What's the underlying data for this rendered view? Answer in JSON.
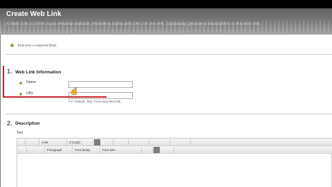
{
  "header": {
    "title": "Create Web Link",
    "subtitle": "A Web Link is a link to an external website. Provide a name and URL for the link. Optionally, provide a description of the web link."
  },
  "required_note": "Indicates a required field.",
  "section1": {
    "number": "1.",
    "title": "Web Link Information",
    "name_label": "Name",
    "url_label": "URL",
    "name_value": "",
    "url_value": "",
    "url_example": "For example, http://www.myschool.edu"
  },
  "section2": {
    "number": "2.",
    "title": "Description",
    "text_label": "Text"
  },
  "editor": {
    "row1": [
      "",
      "Arial",
      "3 (12pt)",
      "",
      "",
      "",
      "",
      ""
    ],
    "row2": [
      "",
      "",
      "Paragraph",
      "Font family",
      "Font size",
      "",
      ""
    ]
  },
  "colors": {
    "accent_red": "#c8202a",
    "required_dot": "#a59d4e",
    "header_dark": "#5e5e5e"
  },
  "icons": {
    "required": "dot-icon",
    "cursor": "hand-cursor-icon"
  }
}
